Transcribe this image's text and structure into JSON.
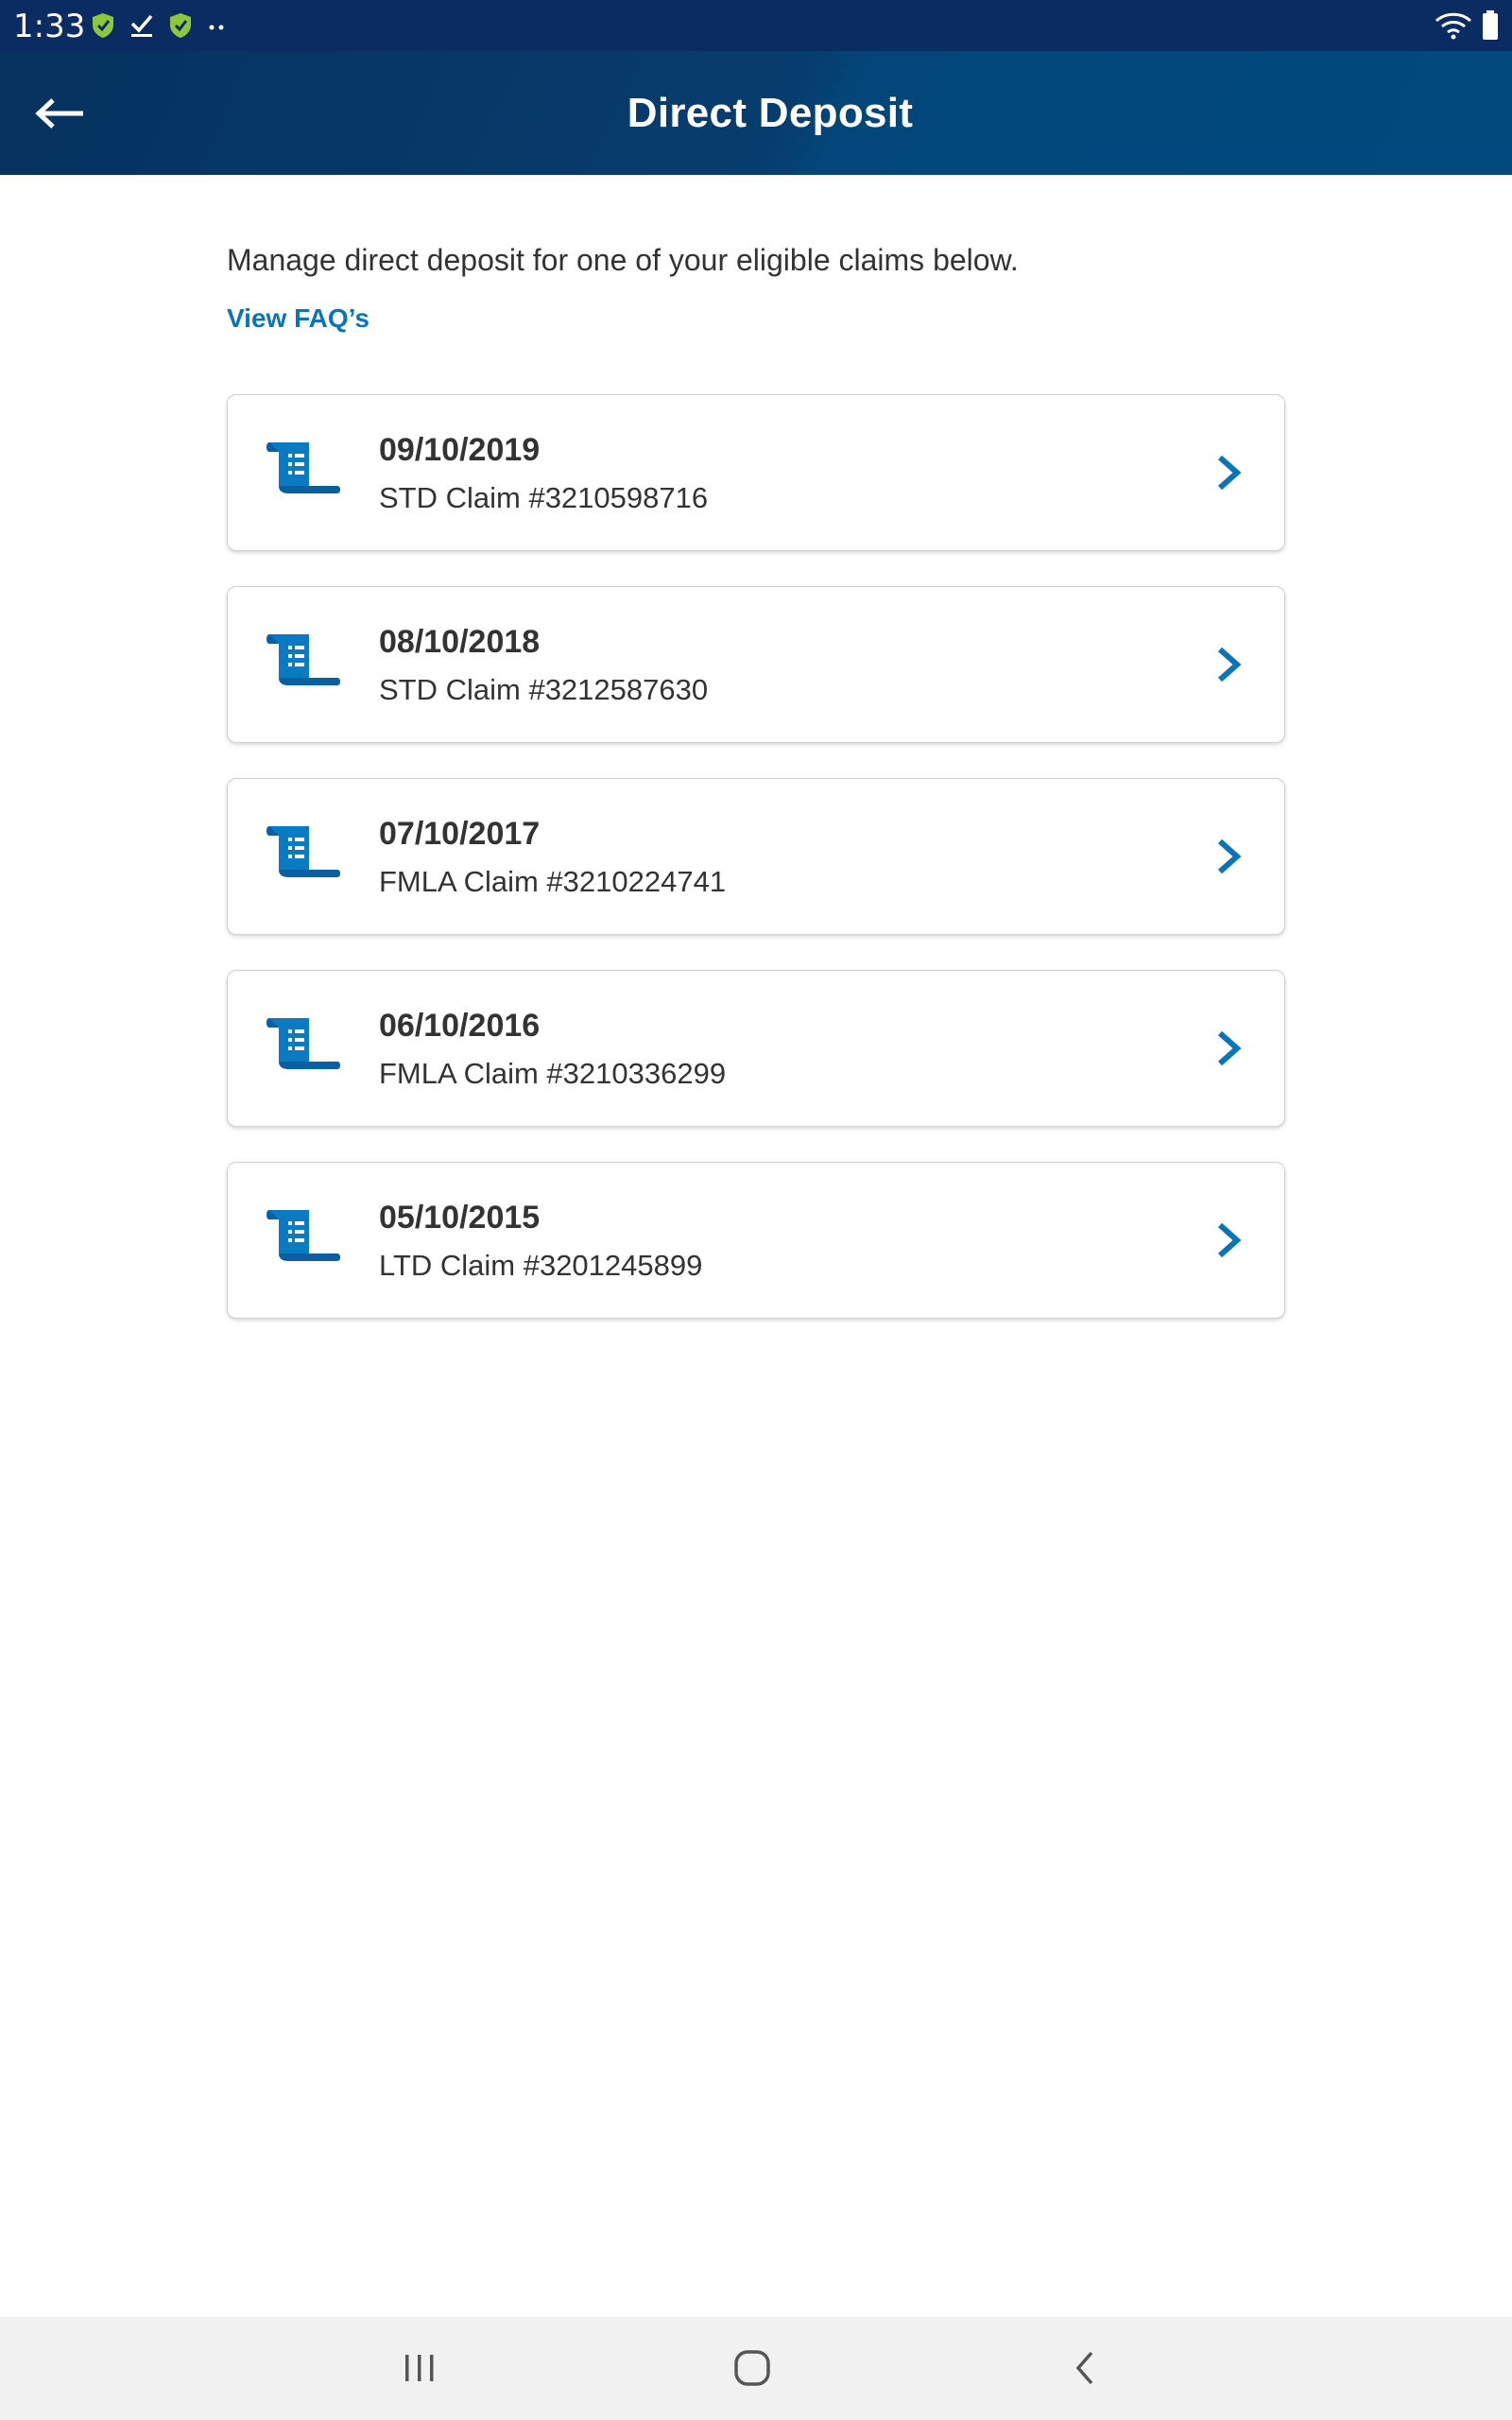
{
  "status_bar": {
    "time": "1:33",
    "left_icons": [
      "shield-check-icon",
      "checkmark-icon",
      "shield-check-icon",
      "more-dots-icon"
    ],
    "right_icons": [
      "wifi-icon",
      "battery-icon"
    ]
  },
  "app_bar": {
    "title": "Direct Deposit",
    "back_icon": "arrow-left-icon"
  },
  "main": {
    "intro_text": "Manage direct deposit for one of your eligible claims below.",
    "faq_link": "View FAQ’s",
    "claims": [
      {
        "date": "09/10/2019",
        "label": "STD Claim #3210598716"
      },
      {
        "date": "08/10/2018",
        "label": "STD Claim #3212587630"
      },
      {
        "date": "07/10/2017",
        "label": "FMLA Claim #3210224741"
      },
      {
        "date": "06/10/2016",
        "label": "FMLA Claim #3210336299"
      },
      {
        "date": "05/10/2015",
        "label": "LTD Claim #3201245899"
      }
    ]
  },
  "nav_bar": {
    "buttons": [
      "recent-apps-icon",
      "home-icon",
      "back-icon"
    ]
  },
  "colors": {
    "status_bar_bg": "#0b2b63",
    "app_bar_bg": "#06325f",
    "accent_link": "#0a74b9",
    "icon_blue": "#0a7bc2",
    "text_dark": "#333333",
    "nav_bar_bg": "#f1f1f1"
  }
}
